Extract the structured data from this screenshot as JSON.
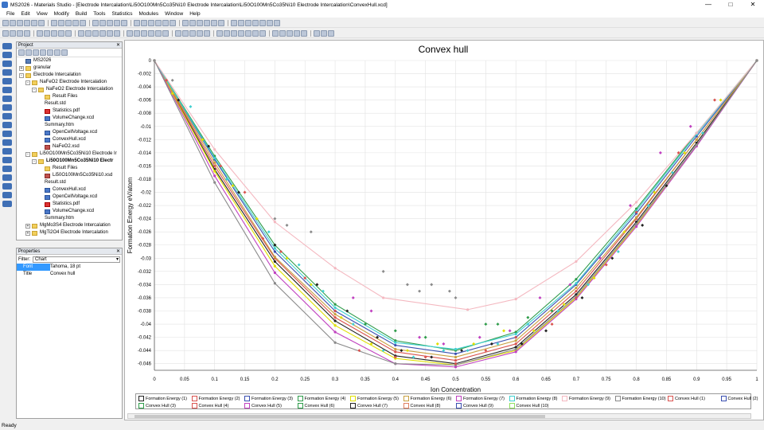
{
  "window": {
    "title": "MS2026 - Materials Studio - [Electrode Intercalation\\Li50O100Mn5Co35Ni10 Electrode Intercalation\\Li50O100Mn5Co35Ni10 Electrode Intercalation\\ConvexHull.xcd]",
    "min": "—",
    "max": "□",
    "close": "✕"
  },
  "menu": [
    "File",
    "Edit",
    "View",
    "Modify",
    "Build",
    "Tools",
    "Statistics",
    "Modules",
    "Window",
    "Help"
  ],
  "project": {
    "header": "Project",
    "items": [
      {
        "label": "MS2026",
        "icon": "root",
        "level": 0,
        "exp": ""
      },
      {
        "label": "granular",
        "icon": "folder",
        "level": 0,
        "exp": "+"
      },
      {
        "label": "Electrode Intercalation",
        "icon": "folder",
        "level": 0,
        "exp": "-"
      },
      {
        "label": "NaFeO2 Electrode Intercalation",
        "icon": "folder",
        "level": 1,
        "exp": "-"
      },
      {
        "label": "NaFeO2 Electrode Intercalation",
        "icon": "folder",
        "level": 2,
        "exp": "-"
      },
      {
        "label": "Result Files",
        "icon": "folder",
        "level": 3,
        "exp": ""
      },
      {
        "label": "Result.std",
        "icon": "doc",
        "level": 3,
        "exp": ""
      },
      {
        "label": "Statistics.pdf",
        "icon": "pdf",
        "level": 3,
        "exp": ""
      },
      {
        "label": "VolumeChange.xcd",
        "icon": "chart",
        "level": 3,
        "exp": ""
      },
      {
        "label": "Summary.htm",
        "icon": "doc",
        "level": 3,
        "exp": ""
      },
      {
        "label": "OpenCellVoltage.xcd",
        "icon": "chart",
        "level": 3,
        "exp": ""
      },
      {
        "label": "ConvexHull.xcd",
        "icon": "chart",
        "level": 3,
        "exp": ""
      },
      {
        "label": "NaFeO2.xsd",
        "icon": "xsd",
        "level": 3,
        "exp": ""
      },
      {
        "label": "Li50O100Mn5Co35Ni10 Electrode Ir",
        "icon": "folder",
        "level": 1,
        "exp": "-"
      },
      {
        "label": "Li50O100Mn5Co35Ni10 Electr",
        "icon": "folder",
        "level": 2,
        "exp": "-",
        "bold": true
      },
      {
        "label": "Result Files",
        "icon": "folder",
        "level": 3,
        "exp": ""
      },
      {
        "label": "Li50O100Mn5Co35Ni10.xsd",
        "icon": "xsd",
        "level": 3,
        "exp": ""
      },
      {
        "label": "Result.std",
        "icon": "doc",
        "level": 3,
        "exp": ""
      },
      {
        "label": "ConvexHull.xcd",
        "icon": "chart",
        "level": 3,
        "exp": ""
      },
      {
        "label": "OpenCellVoltage.xcd",
        "icon": "chart",
        "level": 3,
        "exp": ""
      },
      {
        "label": "Statistics.pdf",
        "icon": "pdf",
        "level": 3,
        "exp": ""
      },
      {
        "label": "VolumeChange.xcd",
        "icon": "chart",
        "level": 3,
        "exp": ""
      },
      {
        "label": "Summary.htm",
        "icon": "doc",
        "level": 3,
        "exp": ""
      },
      {
        "label": "MgMo3S4 Electrode Intercalation",
        "icon": "folder",
        "level": 1,
        "exp": "+"
      },
      {
        "label": "MgTi2O4 Electrode Intercalation",
        "icon": "folder",
        "level": 1,
        "exp": "+"
      }
    ]
  },
  "properties": {
    "header": "Properties",
    "filter_label": "Filter:",
    "filter_value": "Chart",
    "rows": [
      {
        "k": "Font",
        "v": "Tahoma, 18 pt"
      },
      {
        "k": "Title",
        "v": "Convex hull"
      }
    ]
  },
  "status": "Ready",
  "chart_data": {
    "type": "line",
    "title": "Convex hull",
    "xlabel": "Ion Concentration",
    "ylabel": "Formation Energy eV/atom",
    "xlim": [
      0,
      1
    ],
    "ylim": [
      -0.047,
      0
    ],
    "xticks": [
      "0",
      "0.05",
      "0.1",
      "0.15",
      "0.2",
      "0.25",
      "0.3",
      "0.35",
      "0.4",
      "0.45",
      "0.5",
      "0.55",
      "0.6",
      "0.65",
      "0.7",
      "0.75",
      "0.8",
      "0.85",
      "0.9",
      "0.95",
      "1"
    ],
    "yticks": [
      "0",
      "-0.002",
      "-0.004",
      "-0.006",
      "-0.008",
      "-0.01",
      "-0.012",
      "-0.014",
      "-0.016",
      "-0.018",
      "-0.02",
      "-0.022",
      "-0.024",
      "-0.026",
      "-0.028",
      "-0.03",
      "-0.032",
      "-0.034",
      "-0.036",
      "-0.038",
      "-0.04",
      "-0.042",
      "-0.044",
      "-0.046"
    ],
    "grid": true,
    "legend_position": "bottom",
    "colors": [
      "#222222",
      "#d9534f",
      "#3a4fb0",
      "#2e9c4a",
      "#e0e000",
      "#c8a040",
      "#c040c0",
      "#40d0d0",
      "#f4b8c0",
      "#8a8a8a"
    ],
    "series": [
      {
        "name": "Convex Hull (1)",
        "x": [
          0,
          0.1,
          0.2,
          0.3,
          0.4,
          0.5,
          0.6,
          0.7,
          0.8,
          0.9,
          1
        ],
        "y": [
          0,
          -0.0165,
          -0.0305,
          -0.0395,
          -0.0448,
          -0.046,
          -0.0435,
          -0.0355,
          -0.0245,
          -0.0125,
          0
        ]
      },
      {
        "name": "Convex Hull (2)",
        "x": [
          0,
          0.1,
          0.2,
          0.3,
          0.4,
          0.5,
          0.6,
          0.7,
          0.8,
          0.9,
          1
        ],
        "y": [
          0,
          -0.016,
          -0.03,
          -0.039,
          -0.0442,
          -0.0455,
          -0.043,
          -0.035,
          -0.024,
          -0.012,
          0
        ]
      },
      {
        "name": "Convex Hull (3)",
        "x": [
          0,
          0.1,
          0.2,
          0.3,
          0.4,
          0.5,
          0.6,
          0.7,
          0.8,
          0.9,
          1
        ],
        "y": [
          0,
          -0.015,
          -0.029,
          -0.038,
          -0.0432,
          -0.0445,
          -0.042,
          -0.034,
          -0.0232,
          -0.0115,
          0
        ]
      },
      {
        "name": "Convex Hull (4)",
        "x": [
          0,
          0.1,
          0.2,
          0.3,
          0.4,
          0.5,
          0.6,
          0.7,
          0.8,
          0.9,
          1
        ],
        "y": [
          0,
          -0.0145,
          -0.028,
          -0.037,
          -0.0425,
          -0.044,
          -0.0412,
          -0.0332,
          -0.0225,
          -0.011,
          0
        ]
      },
      {
        "name": "Convex Hull (5)",
        "x": [
          0,
          0.1,
          0.2,
          0.3,
          0.4,
          0.5,
          0.6,
          0.7,
          0.8,
          0.9,
          1
        ],
        "y": [
          0,
          -0.0168,
          -0.0312,
          -0.0402,
          -0.0452,
          -0.0462,
          -0.044,
          -0.036,
          -0.025,
          -0.0128,
          0
        ]
      },
      {
        "name": "Convex Hull (6)",
        "x": [
          0,
          0.1,
          0.2,
          0.3,
          0.4,
          0.5,
          0.6,
          0.7,
          0.8,
          0.9,
          1
        ],
        "y": [
          0,
          -0.0155,
          -0.0298,
          -0.0385,
          -0.0438,
          -0.045,
          -0.0425,
          -0.0345,
          -0.0238,
          -0.012,
          0
        ]
      },
      {
        "name": "Convex Hull (7)",
        "x": [
          0,
          0.1,
          0.2,
          0.3,
          0.4,
          0.5,
          0.6,
          0.7,
          0.8,
          0.9,
          1
        ],
        "y": [
          0,
          -0.0175,
          -0.0322,
          -0.0412,
          -0.046,
          -0.0465,
          -0.0442,
          -0.0362,
          -0.0252,
          -0.013,
          0
        ]
      },
      {
        "name": "Convex Hull (8)",
        "x": [
          0,
          0.1,
          0.2,
          0.3,
          0.4,
          0.5,
          0.6,
          0.7,
          0.8,
          0.9,
          1
        ],
        "y": [
          0,
          -0.0148,
          -0.0285,
          -0.0375,
          -0.0428,
          -0.0438,
          -0.0415,
          -0.0338,
          -0.0228,
          -0.0112,
          0
        ]
      },
      {
        "name": "Convex Hull (9)",
        "x": [
          0,
          0.1,
          0.2,
          0.3,
          0.38,
          0.52,
          0.6,
          0.7,
          0.8,
          0.9,
          1
        ],
        "y": [
          0,
          -0.0135,
          -0.0245,
          -0.0315,
          -0.036,
          -0.0378,
          -0.0362,
          -0.0305,
          -0.0215,
          -0.011,
          0
        ]
      },
      {
        "name": "Convex Hull (10)",
        "x": [
          0,
          0.1,
          0.2,
          0.3,
          0.4,
          0.5,
          0.6,
          0.7,
          0.8,
          0.9,
          1
        ],
        "y": [
          0,
          -0.0185,
          -0.0338,
          -0.0428,
          -0.046,
          -0.0462,
          -0.0438,
          -0.0358,
          -0.0248,
          -0.0128,
          0
        ]
      }
    ],
    "scatter": [
      {
        "name": "Formation Energy (1)",
        "x": [
          0.02,
          0.04,
          0.11,
          0.15,
          0.18,
          0.21,
          0.25,
          0.3,
          0.34,
          0.4,
          0.45,
          0.5,
          0.55,
          0.6,
          0.66,
          0.7,
          0.75,
          0.8,
          0.87,
          0.93
        ],
        "y": [
          -0.003,
          -0.006,
          -0.016,
          -0.02,
          -0.027,
          -0.029,
          -0.033,
          -0.038,
          -0.044,
          -0.045,
          -0.045,
          -0.046,
          -0.044,
          -0.042,
          -0.04,
          -0.036,
          -0.031,
          -0.023,
          -0.014,
          -0.006
        ]
      },
      {
        "name": "Formation Energy (2)",
        "x": [
          0.03,
          0.08,
          0.13,
          0.17,
          0.22,
          0.26,
          0.31,
          0.36,
          0.42,
          0.47,
          0.53,
          0.58,
          0.63,
          0.68,
          0.73,
          0.78,
          0.83,
          0.88,
          0.94
        ],
        "y": [
          -0.005,
          -0.012,
          -0.019,
          -0.024,
          -0.03,
          -0.034,
          -0.039,
          -0.043,
          -0.044,
          -0.043,
          -0.043,
          -0.041,
          -0.041,
          -0.037,
          -0.033,
          -0.026,
          -0.02,
          -0.014,
          -0.006
        ]
      },
      {
        "name": "Formation Energy (3)",
        "x": [
          0.06,
          0.12,
          0.19,
          0.24,
          0.28,
          0.33,
          0.38,
          0.43,
          0.48,
          0.52,
          0.57,
          0.62,
          0.67,
          0.72,
          0.77,
          0.82,
          0.86,
          0.91
        ],
        "y": [
          -0.007,
          -0.018,
          -0.026,
          -0.031,
          -0.035,
          -0.04,
          -0.044,
          -0.045,
          -0.044,
          -0.044,
          -0.043,
          -0.04,
          -0.038,
          -0.034,
          -0.029,
          -0.022,
          -0.017,
          -0.011
        ]
      },
      {
        "name": "Formation Energy (4)",
        "x": [
          0.04,
          0.09,
          0.14,
          0.2,
          0.27,
          0.32,
          0.37,
          0.41,
          0.46,
          0.51,
          0.56,
          0.61,
          0.65,
          0.71,
          0.76,
          0.81,
          0.85
        ],
        "y": [
          -0.006,
          -0.013,
          -0.02,
          -0.028,
          -0.034,
          -0.038,
          -0.042,
          -0.044,
          -0.045,
          -0.044,
          -0.043,
          -0.043,
          -0.041,
          -0.036,
          -0.03,
          -0.025,
          -0.019
        ]
      },
      {
        "name": "Formation Energy (5)",
        "x": [
          0.35,
          0.4,
          0.45,
          0.55,
          0.57,
          0.62,
          0.66
        ],
        "y": [
          -0.04,
          -0.041,
          -0.042,
          -0.04,
          -0.04,
          -0.039,
          -0.038
        ]
      },
      {
        "name": "Formation Energy (8)",
        "x": [
          0.33,
          0.36,
          0.44,
          0.48,
          0.54,
          0.59,
          0.64,
          0.69,
          0.74,
          0.79,
          0.84,
          0.89
        ],
        "y": [
          -0.036,
          -0.038,
          -0.042,
          -0.043,
          -0.042,
          -0.041,
          -0.036,
          -0.034,
          -0.03,
          -0.022,
          -0.014,
          -0.01
        ]
      },
      {
        "name": "Formation Energy (9)",
        "x": [
          0.03,
          0.2,
          0.22,
          0.26,
          0.38,
          0.42,
          0.44,
          0.46,
          0.49,
          0.5
        ],
        "y": [
          -0.003,
          -0.024,
          -0.025,
          -0.026,
          -0.032,
          -0.034,
          -0.035,
          -0.034,
          -0.035,
          -0.036
        ]
      }
    ],
    "legend": [
      {
        "label": "Formation Energy (1)",
        "color": "#222222"
      },
      {
        "label": "Formation Energy (2)",
        "color": "#d9534f"
      },
      {
        "label": "Formation Energy (3)",
        "color": "#3a4fb0"
      },
      {
        "label": "Formation Energy (4)",
        "color": "#2e9c4a"
      },
      {
        "label": "Formation Energy (5)",
        "color": "#e0e000"
      },
      {
        "label": "Formation Energy (6)",
        "color": "#c8a040"
      },
      {
        "label": "Formation Energy (7)",
        "color": "#c040c0"
      },
      {
        "label": "Formation Energy (8)",
        "color": "#40d0d0"
      },
      {
        "label": "Formation Energy (9)",
        "color": "#f4b8c0"
      },
      {
        "label": "Formation Energy (10)",
        "color": "#8a8a8a"
      },
      {
        "label": "Convex Hull (1)",
        "color": "#d9534f"
      },
      {
        "label": "Convex Hull (2)",
        "color": "#3a4fb0"
      },
      {
        "label": "Convex Hull (3)",
        "color": "#2e9c4a"
      },
      {
        "label": "Convex Hull (4)",
        "color": "#d9534f"
      },
      {
        "label": "Convex Hull (5)",
        "color": "#c040c0"
      },
      {
        "label": "Convex Hull (6)",
        "color": "#2e9c4a"
      },
      {
        "label": "Convex Hull (7)",
        "color": "#222222"
      },
      {
        "label": "Convex Hull (8)",
        "color": "#e08060"
      },
      {
        "label": "Convex Hull (9)",
        "color": "#3a4fb0"
      },
      {
        "label": "Convex Hull (10)",
        "color": "#90e060"
      }
    ]
  }
}
